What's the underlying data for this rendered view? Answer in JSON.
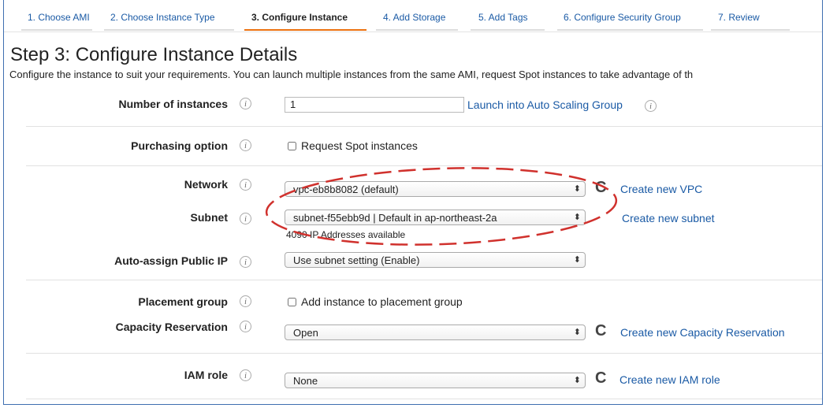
{
  "wizard": {
    "tabs": [
      {
        "label": "1. Choose AMI"
      },
      {
        "label": "2. Choose Instance Type"
      },
      {
        "label": "3. Configure Instance"
      },
      {
        "label": "4. Add Storage"
      },
      {
        "label": "5. Add Tags"
      },
      {
        "label": "6. Configure Security Group"
      },
      {
        "label": "7. Review"
      }
    ],
    "active_index": 2
  },
  "page": {
    "title": "Step 3: Configure Instance Details",
    "description": "Configure the instance to suit your requirements. You can launch multiple instances from the same AMI, request Spot instances to take advantage of th"
  },
  "fields": {
    "num_instances": {
      "label": "Number of instances",
      "value": "1",
      "link": "Launch into Auto Scaling Group"
    },
    "purchasing": {
      "label": "Purchasing option",
      "checkbox_label": "Request Spot instances"
    },
    "network": {
      "label": "Network",
      "selected": "vpc-eb8b8082 (default)",
      "link": "Create new VPC"
    },
    "subnet": {
      "label": "Subnet",
      "selected": "subnet-f55ebb9d | Default in ap-northeast-2a",
      "hint": "4090 IP Addresses available",
      "link": "Create new subnet"
    },
    "public_ip": {
      "label": "Auto-assign Public IP",
      "selected": "Use subnet setting (Enable)"
    },
    "placement": {
      "label": "Placement group",
      "checkbox_label": "Add instance to placement group"
    },
    "capacity": {
      "label": "Capacity Reservation",
      "selected": "Open",
      "link": "Create new Capacity Reservation"
    },
    "iam": {
      "label": "IAM role",
      "selected": "None",
      "link": "Create new IAM role"
    }
  },
  "icons": {
    "info": "info-icon",
    "refresh": "refresh-icon",
    "caret": "select-caret-icon"
  },
  "info_glyph": "i",
  "refresh_glyph": "C",
  "caret_glyph": "⬍",
  "colors": {
    "link": "#1a5aa5",
    "active_tab_underline": "#ec7211",
    "annotation": "#d0312d",
    "frame_border": "#3f6fb0"
  }
}
